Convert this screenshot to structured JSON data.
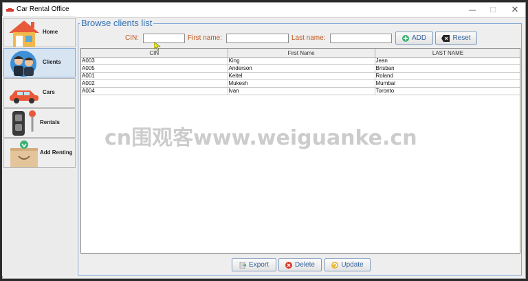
{
  "window": {
    "title": "Car Rental Office",
    "minimize": "—",
    "maximize": "☐",
    "close": "✕"
  },
  "sidebar": {
    "items": [
      {
        "label": "Home",
        "icon": "house-icon"
      },
      {
        "label": "Clients",
        "icon": "people-icon"
      },
      {
        "label": "Cars",
        "icon": "car-icon"
      },
      {
        "label": "Rentals",
        "icon": "car-key-icon"
      },
      {
        "label": "Add Renting",
        "icon": "box-download-icon"
      }
    ],
    "active": "Clients"
  },
  "panel": {
    "title": "Browse clients list"
  },
  "filters": {
    "cin_label": "CIN:",
    "cin_value": "",
    "first_label": "First name:",
    "first_value": "",
    "last_label": "Last name:",
    "last_value": "",
    "add_label": "ADD",
    "reset_label": "Reset"
  },
  "table": {
    "columns": [
      "CIN",
      "First Name",
      "LAST NAME"
    ],
    "rows": [
      [
        "A003",
        "King",
        "Jean"
      ],
      [
        "A005",
        "Anderson",
        "Brisban"
      ],
      [
        "A001",
        "Keitel",
        "Roland"
      ],
      [
        "A002",
        "Mukesh",
        "Mumbai"
      ],
      [
        "A004",
        "Ivan",
        "Toronto"
      ]
    ]
  },
  "actions": {
    "export_label": "Export",
    "delete_label": "Delete",
    "update_label": "Update"
  },
  "watermark": "cn围观客www.weiguanke.cn",
  "colors": {
    "accent": "#2f6fb4",
    "label": "#c0561d",
    "border": "#7ea6d4"
  }
}
